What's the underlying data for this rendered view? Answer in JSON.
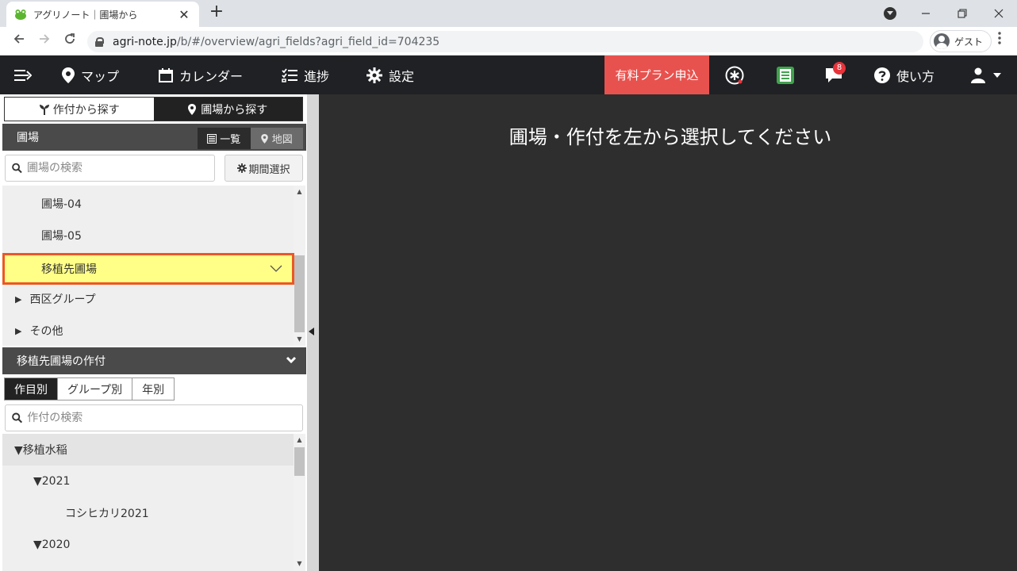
{
  "browser": {
    "tab_title": "アグリノート｜圃場から",
    "url_host": "agri-note.jp",
    "url_path": "/b/#/overview/agri_fields?agri_field_id=704235",
    "profile_label": "ゲスト"
  },
  "header": {
    "map": "マップ",
    "calendar": "カレンダー",
    "progress": "進捗",
    "settings": "設定",
    "paid_plan": "有料プラン申込",
    "notifications_count": "8",
    "help": "使い方"
  },
  "search_mode": {
    "by_crop": "作付から探す",
    "by_field": "圃場から探す",
    "selected": "by_field"
  },
  "fields": {
    "title": "圃場",
    "view_list": "一覧",
    "view_map": "地図",
    "search_placeholder": "圃場の検索",
    "period_button": "期間選択",
    "items": [
      {
        "label": "圃場-04",
        "type": "field"
      },
      {
        "label": "圃場-05",
        "type": "field"
      },
      {
        "label": "移植先圃場",
        "type": "field",
        "selected": true
      },
      {
        "label": "西区グループ",
        "type": "group"
      },
      {
        "label": "その他",
        "type": "group"
      }
    ]
  },
  "crops": {
    "title": "移植先圃場の作付",
    "tabs": [
      "作目別",
      "グループ別",
      "年別"
    ],
    "active_tab": "作目別",
    "search_placeholder": "作付の検索",
    "items": [
      {
        "label": "▼移植水稲",
        "level": 0
      },
      {
        "label": "▼2021",
        "level": 1
      },
      {
        "label": "コシヒカリ2021",
        "level": 2
      },
      {
        "label": "▼2020",
        "level": 1
      }
    ]
  },
  "main": {
    "message": "圃場・作付を左から選択してください"
  },
  "colors": {
    "header_bg": "#1f2124",
    "paid_plan_bg": "#e8524e",
    "selected_row_bg": "#ffff88",
    "selected_row_border": "#ed5722",
    "main_bg": "#2e2e2e"
  }
}
